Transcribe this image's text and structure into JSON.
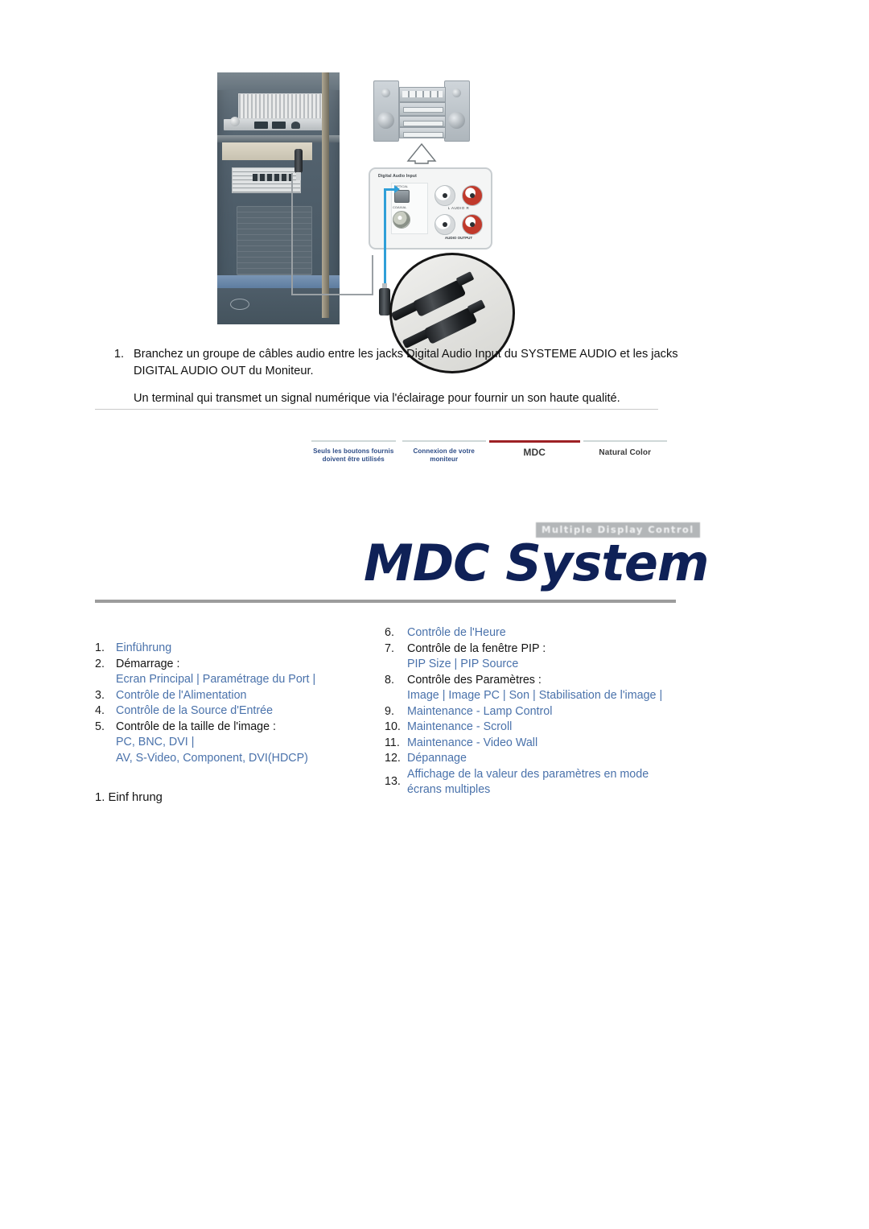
{
  "diagram": {
    "alt_name": "optical-audio-connection-diagram",
    "panel": {
      "title": "Digital Audio Input",
      "optical_label": "OPTICAL",
      "coaxial_label": "COAXIAL",
      "rca_labels": "L   AUDIO   R",
      "output_label": "AUDIO OUTPUT"
    }
  },
  "instructions": {
    "step_number": "1.",
    "step_text": "Branchez un groupe de câbles audio entre les jacks Digital Audio Input du SYSTEME AUDIO et les jacks DIGITAL AUDIO OUT  du Moniteur.",
    "note": "Un terminal qui transmet un signal numérique via l'éclairage pour fournir un son haute qualité."
  },
  "banner": {
    "tabs": [
      {
        "label": "Seuls les boutons fournis doivent être utilisés",
        "state": "inactive"
      },
      {
        "label": "Connexion de votre moniteur",
        "state": "inactive"
      },
      {
        "label": "MDC",
        "state": "active"
      },
      {
        "label": "Natural Color",
        "state": "inactive"
      }
    ],
    "badge": "Multiple Display Control",
    "title": "MDC System",
    "accent_color": "#9d2124",
    "title_color": "#0f2157"
  },
  "toc": {
    "left": [
      {
        "num": "1.",
        "title": "Einführung",
        "title_link": true,
        "sub": ""
      },
      {
        "num": "2.",
        "title": "Démarrage :",
        "title_link": false,
        "sub": "Ecran Principal | Paramétrage du Port |"
      },
      {
        "num": "3.",
        "title": "Contrôle de l'Alimentation",
        "title_link": true,
        "sub": ""
      },
      {
        "num": "4.",
        "title": "Contrôle de la Source d'Entrée",
        "title_link": true,
        "sub": ""
      },
      {
        "num": "5.",
        "title": "Contrôle de la taille de l'image :",
        "title_link": false,
        "sub": "PC, BNC, DVI |\nAV, S-Video, Component, DVI(HDCP)"
      }
    ],
    "right": [
      {
        "num": "6.",
        "title": "Contrôle de l'Heure",
        "title_link": true,
        "sub": ""
      },
      {
        "num": "7.",
        "title": "Contrôle de la fenêtre PIP :",
        "title_link": false,
        "sub": "PIP Size | PIP Source"
      },
      {
        "num": "8.",
        "title": "Contrôle des Paramètres :",
        "title_link": false,
        "sub": "Image | Image PC | Son | Stabilisation de l'image |"
      },
      {
        "num": "9.",
        "title": "Maintenance - Lamp Control",
        "title_link": true,
        "sub": ""
      },
      {
        "num": "10.",
        "title": "Maintenance - Scroll",
        "title_link": true,
        "sub": ""
      },
      {
        "num": "11.",
        "title": "Maintenance - Video Wall",
        "title_link": true,
        "sub": ""
      },
      {
        "num": "12.",
        "title": "Dépannage",
        "title_link": true,
        "sub": ""
      },
      {
        "num": "13.",
        "title": "Affichage de la valeur des paramètres en mode écrans multiples",
        "title_link": true,
        "sub": ""
      }
    ],
    "link_color": "#4a72ab"
  },
  "footer": {
    "heading": "1. Einf hrung"
  }
}
